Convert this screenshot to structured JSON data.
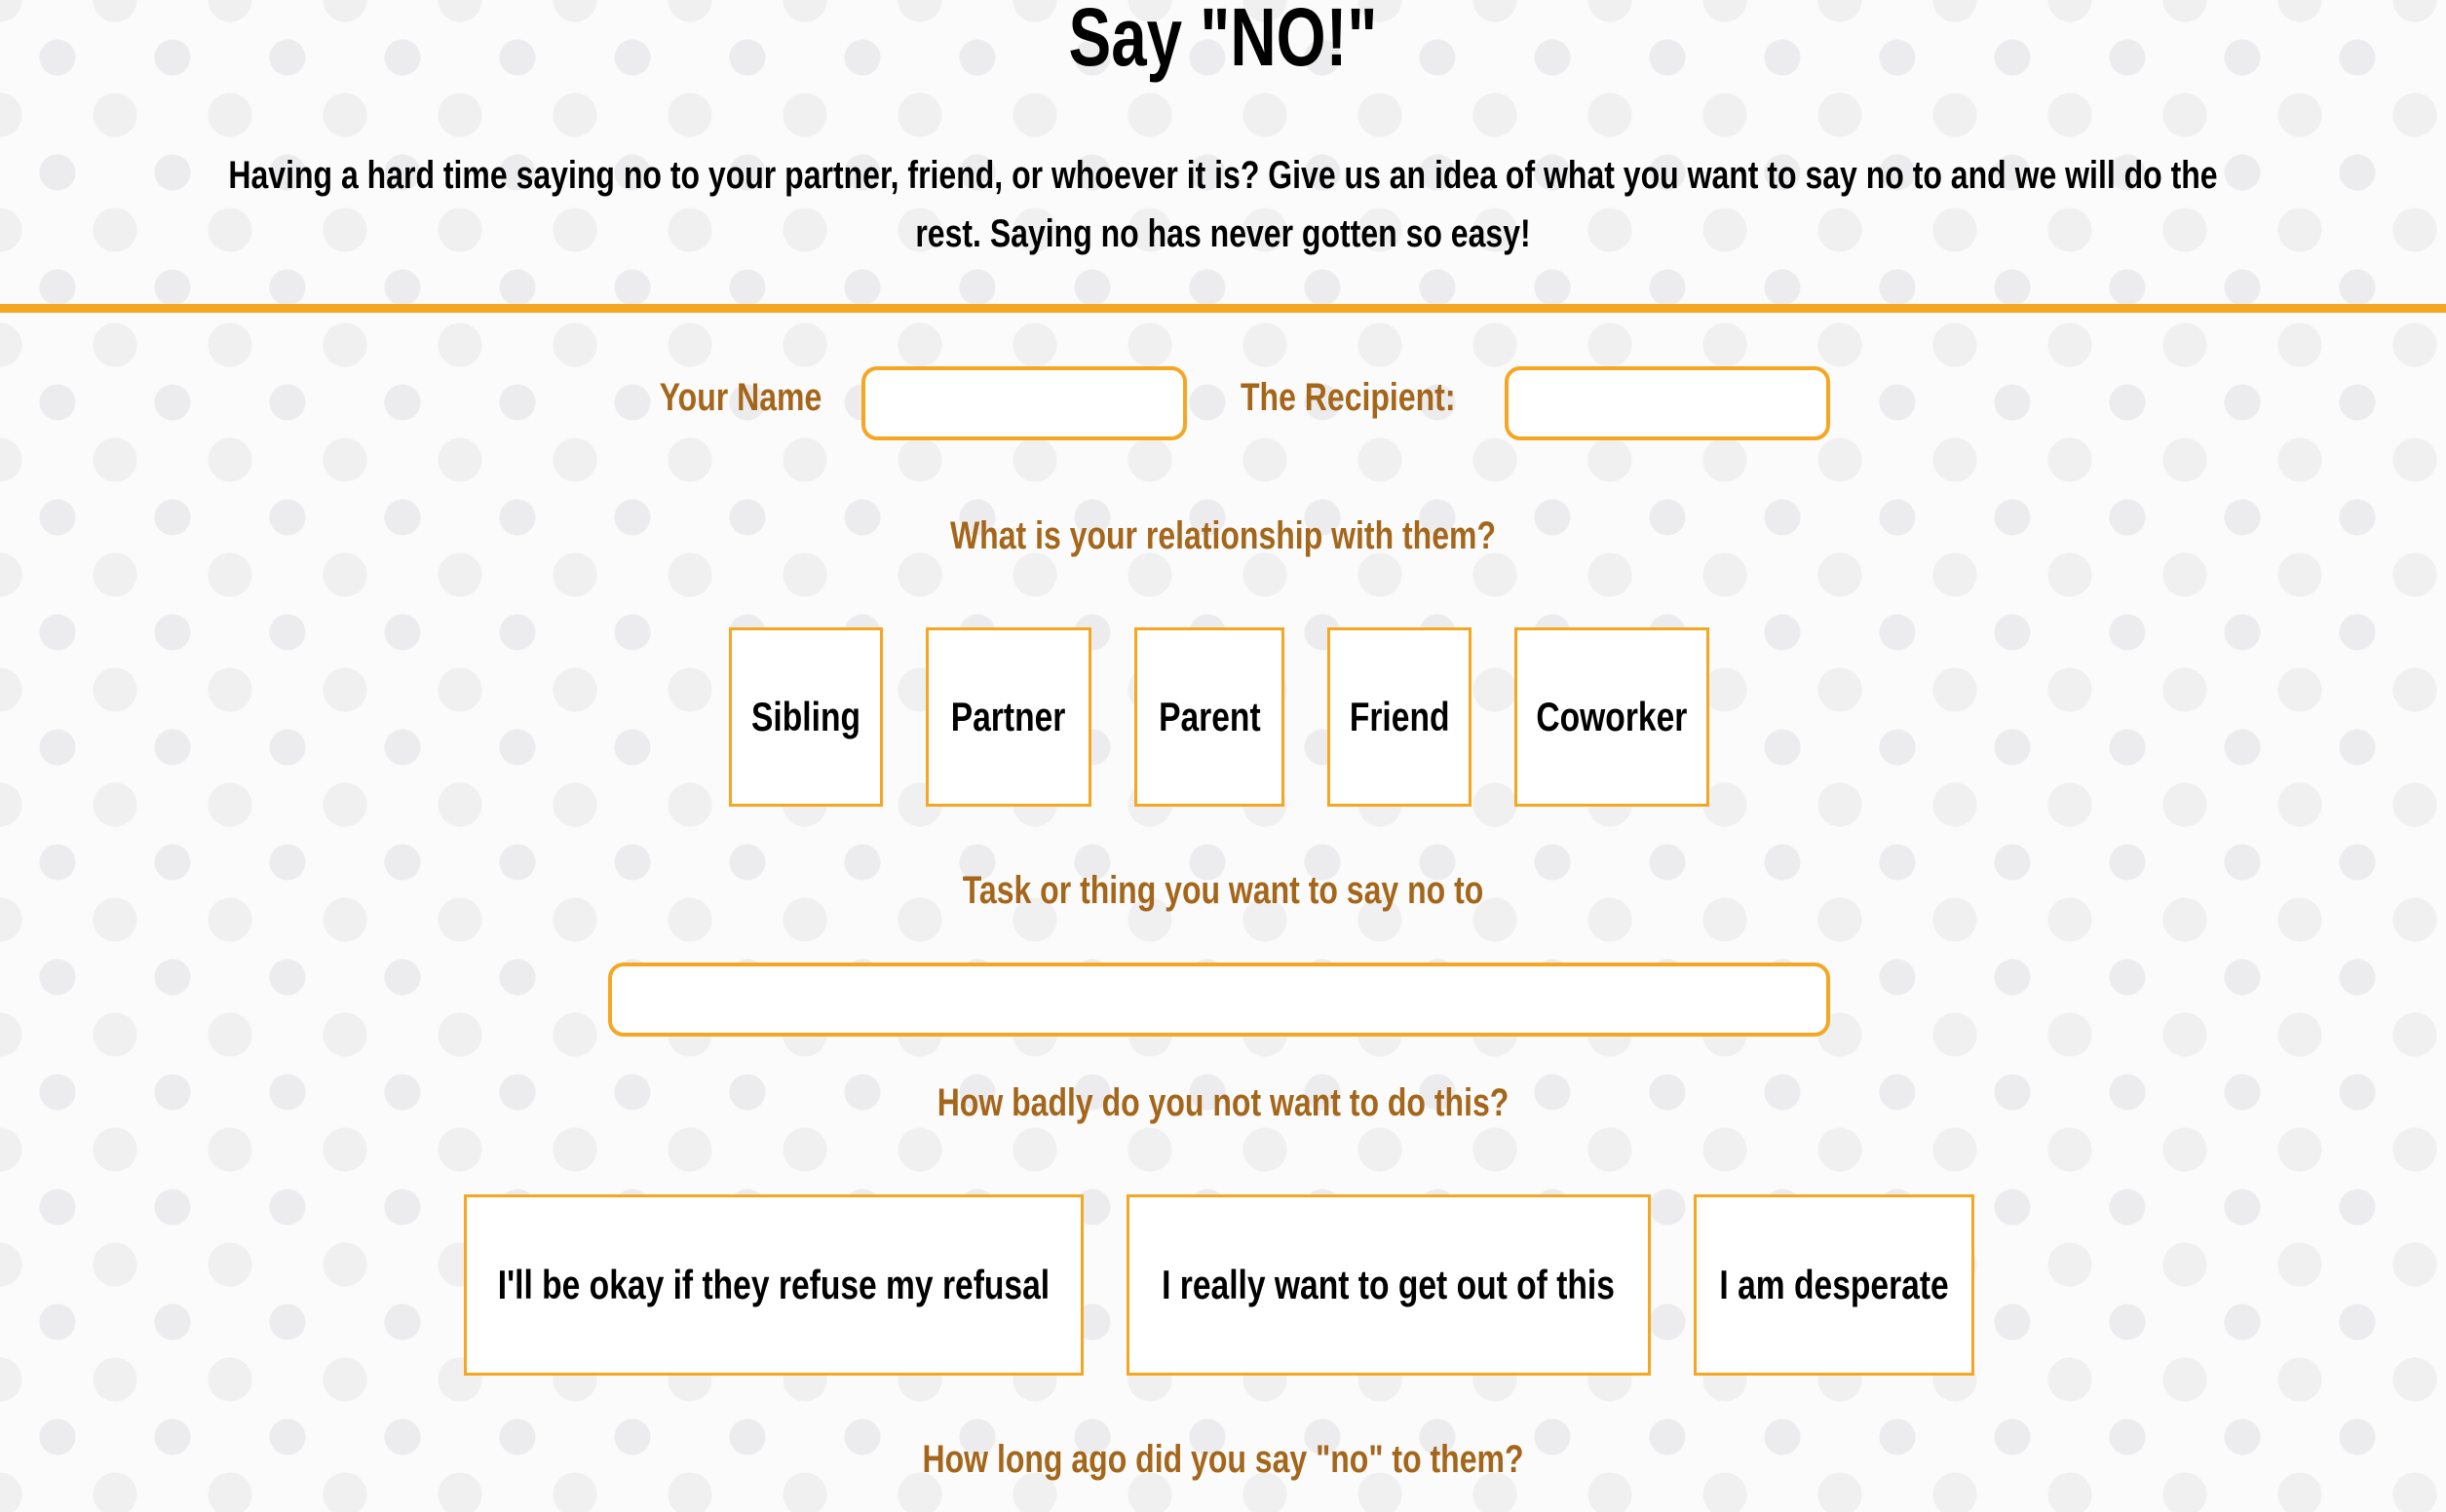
{
  "header": {
    "title": "Say \"NO!\"",
    "intro": "Having a hard time saying no to your partner, friend, or whoever it is? Give us an idea of what you want to say no to and we will do the rest. Saying no has never gotten so easy!"
  },
  "form": {
    "your_name_label": "Your Name",
    "your_name_value": "",
    "recipient_label": "The Recipient:",
    "recipient_value": "",
    "relationship_question": "What is your relationship with them?",
    "relationships": [
      "Sibling",
      "Partner",
      "Parent",
      "Friend",
      "Coworker"
    ],
    "task_label": "Task or thing you want to say no to",
    "task_value": "",
    "badness_question": "How badly do you not want to do this?",
    "badness_options": [
      "I'll be okay if they refuse my refusal",
      "I really want to get out of this",
      "I am desperate"
    ],
    "how_long_question": "How long ago did you say \"no\" to them?"
  },
  "colors": {
    "accent": "#f5a623",
    "label": "#a4661a",
    "background": "#fbfbfb"
  }
}
